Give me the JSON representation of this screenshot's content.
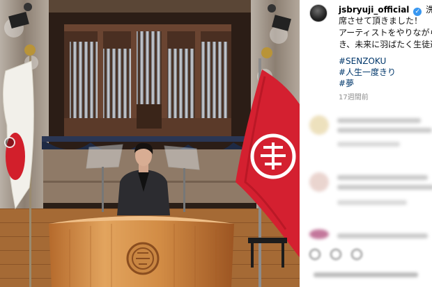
{
  "post": {
    "username": "jsbryuji_official",
    "header_suffix": "洗足学園",
    "caption_lines": [
      "席させて頂きました！",
      "アーティストをやりながら",
      "き、未来に羽ばたく生徒達"
    ],
    "hashtags": [
      "#SENZOKU",
      "#人生一度きり",
      "#夢"
    ],
    "time_ago": "17週間前"
  },
  "colors": {
    "flag_red": "#d21f2b",
    "banner_red": "#d42030",
    "hashtag": "#00376b",
    "verified": "#3897f0"
  },
  "icons": [
    "verified-badge-icon",
    "carousel-indicator-icon",
    "heart-icon",
    "comment-icon",
    "share-icon"
  ]
}
